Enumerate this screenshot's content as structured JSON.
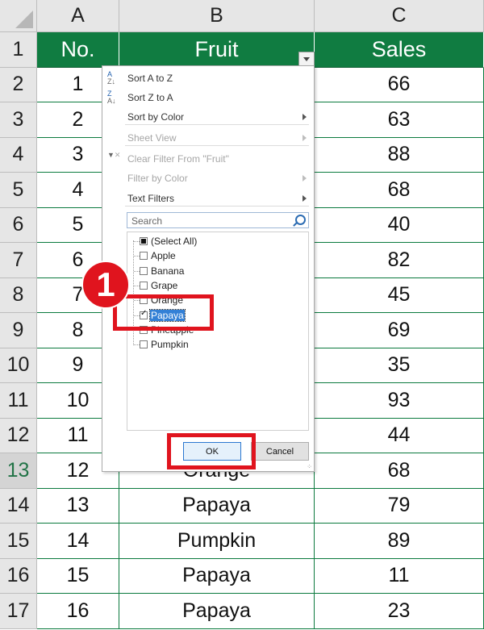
{
  "columns": [
    "A",
    "B",
    "C"
  ],
  "header_row": {
    "row": "1",
    "cells": [
      "No.",
      "Fruit",
      "Sales"
    ]
  },
  "rows": [
    {
      "row": "2",
      "no": "1",
      "fruit": "",
      "sales": "66"
    },
    {
      "row": "3",
      "no": "2",
      "fruit": "",
      "sales": "63"
    },
    {
      "row": "4",
      "no": "3",
      "fruit": "",
      "sales": "88"
    },
    {
      "row": "5",
      "no": "4",
      "fruit": "",
      "sales": "68"
    },
    {
      "row": "6",
      "no": "5",
      "fruit": "",
      "sales": "40"
    },
    {
      "row": "7",
      "no": "6",
      "fruit": "",
      "sales": "82"
    },
    {
      "row": "8",
      "no": "7",
      "fruit": "",
      "sales": "45"
    },
    {
      "row": "9",
      "no": "8",
      "fruit": "",
      "sales": "69"
    },
    {
      "row": "10",
      "no": "9",
      "fruit": "",
      "sales": "35"
    },
    {
      "row": "11",
      "no": "10",
      "fruit": "",
      "sales": "93"
    },
    {
      "row": "12",
      "no": "11",
      "fruit": "",
      "sales": "44"
    },
    {
      "row": "13",
      "no": "12",
      "fruit": "Orange",
      "sales": "68"
    },
    {
      "row": "14",
      "no": "13",
      "fruit": "Papaya",
      "sales": "79"
    },
    {
      "row": "15",
      "no": "14",
      "fruit": "Pumpkin",
      "sales": "89"
    },
    {
      "row": "16",
      "no": "15",
      "fruit": "Papaya",
      "sales": "11"
    },
    {
      "row": "17",
      "no": "16",
      "fruit": "Papaya",
      "sales": "23"
    }
  ],
  "active_row": "13",
  "filter_menu": {
    "items": [
      {
        "label": "Sort A to Z",
        "icon": "sort-az-icon",
        "enabled": true,
        "submenu": false
      },
      {
        "label": "Sort Z to A",
        "icon": "sort-za-icon",
        "enabled": true,
        "submenu": false
      },
      {
        "label": "Sort by Color",
        "icon": "",
        "enabled": true,
        "submenu": true
      },
      {
        "label": "Sheet View",
        "icon": "",
        "enabled": false,
        "submenu": true
      },
      {
        "label": "Clear Filter From \"Fruit\"",
        "icon": "clear-filter-icon",
        "enabled": false,
        "submenu": false
      },
      {
        "label": "Filter by Color",
        "icon": "",
        "enabled": false,
        "submenu": true
      },
      {
        "label": "Text Filters",
        "icon": "",
        "enabled": true,
        "submenu": true
      }
    ],
    "search_placeholder": "Search",
    "list": [
      {
        "label": "(Select All)",
        "state": "partial"
      },
      {
        "label": "Apple",
        "state": "unchecked"
      },
      {
        "label": "Banana",
        "state": "unchecked"
      },
      {
        "label": "Grape",
        "state": "unchecked"
      },
      {
        "label": "Orange",
        "state": "unchecked"
      },
      {
        "label": "Papaya",
        "state": "checked",
        "selected": true
      },
      {
        "label": "Pineapple",
        "state": "unchecked"
      },
      {
        "label": "Pumpkin",
        "state": "unchecked"
      }
    ],
    "ok_label": "OK",
    "cancel_label": "Cancel"
  },
  "annotation": {
    "step_number": "1",
    "color": "#e0141e"
  },
  "colors": {
    "header_green": "#107c41",
    "grid_green": "#0b7a3e",
    "selection_blue": "#3380d6"
  }
}
